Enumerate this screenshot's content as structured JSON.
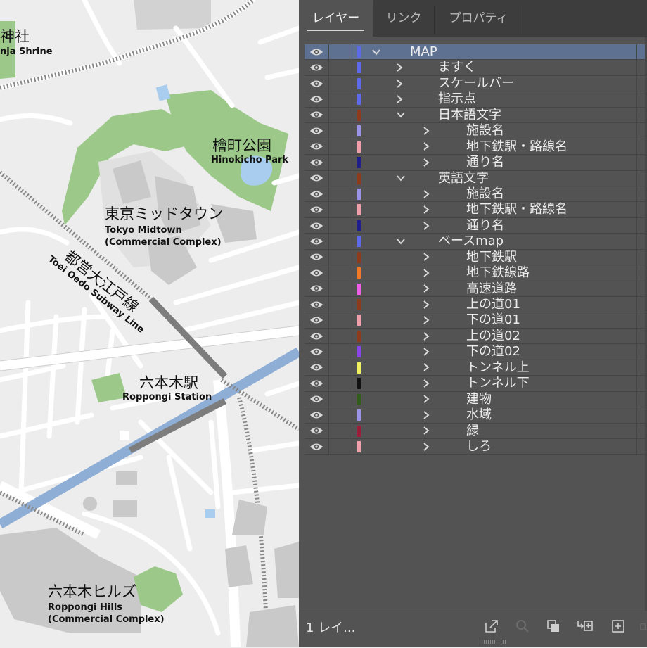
{
  "map": {
    "labels": {
      "shrine_ja": "神社",
      "shrine_en": "nja Shrine",
      "hinokicho_ja": "檜町公園",
      "hinokicho_en": "Hinokicho Park",
      "midtown_ja": "東京ミッドタウン",
      "midtown_en1": "Tokyo Midtown",
      "midtown_en2": "(Commercial Complex)",
      "oedo_ja": "都営大江戸線",
      "oedo_en": "Toei Oedo Subway Line",
      "station_ja": "六本木駅",
      "station_en": "Roppongi Station",
      "hills_ja": "六本木ヒルズ",
      "hills_en1": "Roppongi Hills",
      "hills_en2": "(Commercial Complex)"
    },
    "colors": {
      "background": "#ededed",
      "green": "#9cc98a",
      "building": "#c9c9c9",
      "road": "#ffffff",
      "subway_line": "#8faed6",
      "subway_track": "#7d7d7d",
      "water": "#a9cdee"
    }
  },
  "panel": {
    "tabs": [
      {
        "label": "レイヤー",
        "active": true
      },
      {
        "label": "リンク",
        "active": false
      },
      {
        "label": "プロパティ",
        "active": false
      }
    ],
    "layers": [
      {
        "name": "MAP",
        "level": 0,
        "expanded": true,
        "selected": true,
        "color": "#5c6bea"
      },
      {
        "name": "ますく",
        "level": 1,
        "expanded": false,
        "color": "#5c6bea"
      },
      {
        "name": "スケールバー",
        "level": 1,
        "expanded": false,
        "color": "#5c6bea"
      },
      {
        "name": "指示点",
        "level": 1,
        "expanded": false,
        "color": "#5c6bea"
      },
      {
        "name": "日本語文字",
        "level": 1,
        "expanded": true,
        "color": "#8e3a1c"
      },
      {
        "name": "施設名",
        "level": 2,
        "expanded": false,
        "color": "#9b93e8"
      },
      {
        "name": "地下鉄駅・路線名",
        "level": 2,
        "expanded": false,
        "color": "#f0a0a8"
      },
      {
        "name": "通り名",
        "level": 2,
        "expanded": false,
        "color": "#1e1e8c"
      },
      {
        "name": "英語文字",
        "level": 1,
        "expanded": true,
        "color": "#8e3a1c"
      },
      {
        "name": "施設名",
        "level": 2,
        "expanded": false,
        "color": "#9b93e8"
      },
      {
        "name": "地下鉄駅・路線名",
        "level": 2,
        "expanded": false,
        "color": "#f0a0a8"
      },
      {
        "name": "通り名",
        "level": 2,
        "expanded": false,
        "color": "#1e1e8c"
      },
      {
        "name": "ベースmap",
        "level": 1,
        "expanded": true,
        "color": "#5c6bea"
      },
      {
        "name": "地下鉄駅",
        "level": 2,
        "expanded": false,
        "color": "#8e3a1c"
      },
      {
        "name": "地下鉄線路",
        "level": 2,
        "expanded": false,
        "color": "#f07a28"
      },
      {
        "name": "高速道路",
        "level": 2,
        "expanded": false,
        "color": "#ee5fe8"
      },
      {
        "name": "上の道01",
        "level": 2,
        "expanded": false,
        "color": "#8e3a1c"
      },
      {
        "name": "下の道01",
        "level": 2,
        "expanded": false,
        "color": "#f0a0a8"
      },
      {
        "name": "上の道02",
        "level": 2,
        "expanded": false,
        "color": "#8e3a1c"
      },
      {
        "name": "下の道02",
        "level": 2,
        "expanded": false,
        "color": "#8a45e6"
      },
      {
        "name": "トンネル上",
        "level": 2,
        "expanded": false,
        "color": "#f2f060"
      },
      {
        "name": "トンネル下",
        "level": 2,
        "expanded": false,
        "color": "#111111"
      },
      {
        "name": "建物",
        "level": 2,
        "expanded": false,
        "color": "#2f5e1e"
      },
      {
        "name": "水域",
        "level": 2,
        "expanded": false,
        "color": "#9b93e8"
      },
      {
        "name": "緑",
        "level": 2,
        "expanded": false,
        "color": "#9a1e3a"
      },
      {
        "name": "しろ",
        "level": 2,
        "expanded": false,
        "color": "#f0a0a8"
      }
    ],
    "footer": {
      "layer_count": "1 レイ...",
      "icons": [
        "export-icon",
        "search-icon",
        "clipping-mask-icon",
        "move-to-layer-icon",
        "new-layer-icon",
        "trash-icon"
      ]
    },
    "colors": {
      "panel_bg": "#535353",
      "tabbar_bg": "#3d3d3d",
      "selected_row": "#5f7191"
    }
  }
}
